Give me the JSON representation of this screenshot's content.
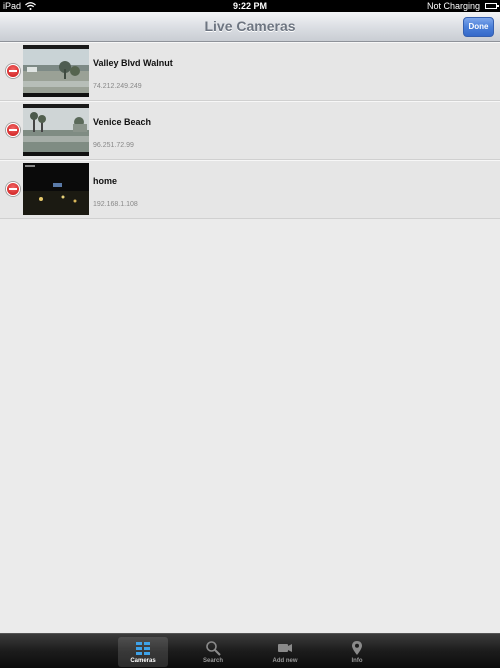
{
  "status": {
    "device": "iPad",
    "time": "9:22 PM",
    "battery_text": "Not Charging"
  },
  "nav": {
    "title": "Live Cameras",
    "done_label": "Done"
  },
  "cameras": [
    {
      "name": "Valley Blvd Walnut",
      "ip": "74.212.249.249"
    },
    {
      "name": "Venice Beach",
      "ip": "96.251.72.99"
    },
    {
      "name": "home",
      "ip": "192.168.1.108"
    }
  ],
  "tabs": [
    {
      "label": "Cameras",
      "icon": "grid-icon",
      "active": true
    },
    {
      "label": "Search",
      "icon": "magnifier-icon",
      "active": false
    },
    {
      "label": "Add new",
      "icon": "camcorder-icon",
      "active": false
    },
    {
      "label": "Info",
      "icon": "pin-icon",
      "active": false
    }
  ],
  "colors": {
    "accent": "#4a7fd9",
    "delete": "#d11a1a"
  }
}
